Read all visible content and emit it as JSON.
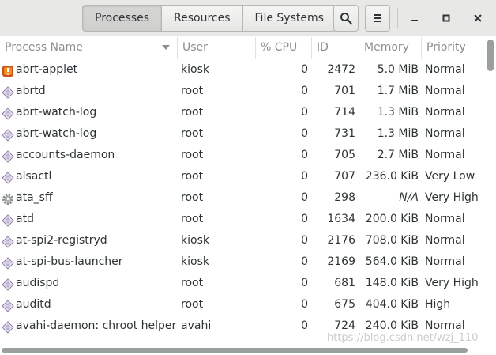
{
  "toolbar": {
    "tabs": [
      {
        "label": "Processes",
        "active": true
      },
      {
        "label": "Resources",
        "active": false
      },
      {
        "label": "File Systems",
        "active": false
      }
    ],
    "search_icon": "search-icon",
    "menu_icon": "hamburger-menu-icon"
  },
  "window_controls": {
    "minimize": "–",
    "maximize": "□",
    "close": "✕"
  },
  "columns": {
    "process_name": "Process Name",
    "user": "User",
    "cpu": "% CPU",
    "id": "ID",
    "memory": "Memory",
    "priority": "Priority"
  },
  "processes": [
    {
      "name": "abrt-applet",
      "user": "kiosk",
      "cpu": "0",
      "id": "2472",
      "memory": "5.0 MiB",
      "priority": "Normal",
      "icon": "alert-app-icon"
    },
    {
      "name": "abrtd",
      "user": "root",
      "cpu": "0",
      "id": "701",
      "memory": "1.7 MiB",
      "priority": "Normal",
      "icon": "executable-icon"
    },
    {
      "name": "abrt-watch-log",
      "user": "root",
      "cpu": "0",
      "id": "714",
      "memory": "1.3 MiB",
      "priority": "Normal",
      "icon": "executable-icon"
    },
    {
      "name": "abrt-watch-log",
      "user": "root",
      "cpu": "0",
      "id": "731",
      "memory": "1.3 MiB",
      "priority": "Normal",
      "icon": "executable-icon"
    },
    {
      "name": "accounts-daemon",
      "user": "root",
      "cpu": "0",
      "id": "705",
      "memory": "2.7 MiB",
      "priority": "Normal",
      "icon": "executable-icon"
    },
    {
      "name": "alsactl",
      "user": "root",
      "cpu": "0",
      "id": "707",
      "memory": "236.0 KiB",
      "priority": "Very Low",
      "icon": "executable-icon"
    },
    {
      "name": "ata_sff",
      "user": "root",
      "cpu": "0",
      "id": "298",
      "memory": "N/A",
      "priority": "Very High",
      "icon": "gear-icon"
    },
    {
      "name": "atd",
      "user": "root",
      "cpu": "0",
      "id": "1634",
      "memory": "200.0 KiB",
      "priority": "Normal",
      "icon": "executable-icon"
    },
    {
      "name": "at-spi2-registryd",
      "user": "kiosk",
      "cpu": "0",
      "id": "2176",
      "memory": "708.0 KiB",
      "priority": "Normal",
      "icon": "executable-icon"
    },
    {
      "name": "at-spi-bus-launcher",
      "user": "kiosk",
      "cpu": "0",
      "id": "2169",
      "memory": "564.0 KiB",
      "priority": "Normal",
      "icon": "executable-icon"
    },
    {
      "name": "audispd",
      "user": "root",
      "cpu": "0",
      "id": "681",
      "memory": "148.0 KiB",
      "priority": "Very High",
      "icon": "executable-icon"
    },
    {
      "name": "auditd",
      "user": "root",
      "cpu": "0",
      "id": "675",
      "memory": "404.0 KiB",
      "priority": "High",
      "icon": "executable-icon"
    },
    {
      "name": "avahi-daemon: chroot helper",
      "user": "avahi",
      "cpu": "0",
      "id": "724",
      "memory": "240.0 KiB",
      "priority": "Normal",
      "icon": "executable-icon"
    }
  ],
  "watermark": "https://blog.csdn.net/wzj_110"
}
